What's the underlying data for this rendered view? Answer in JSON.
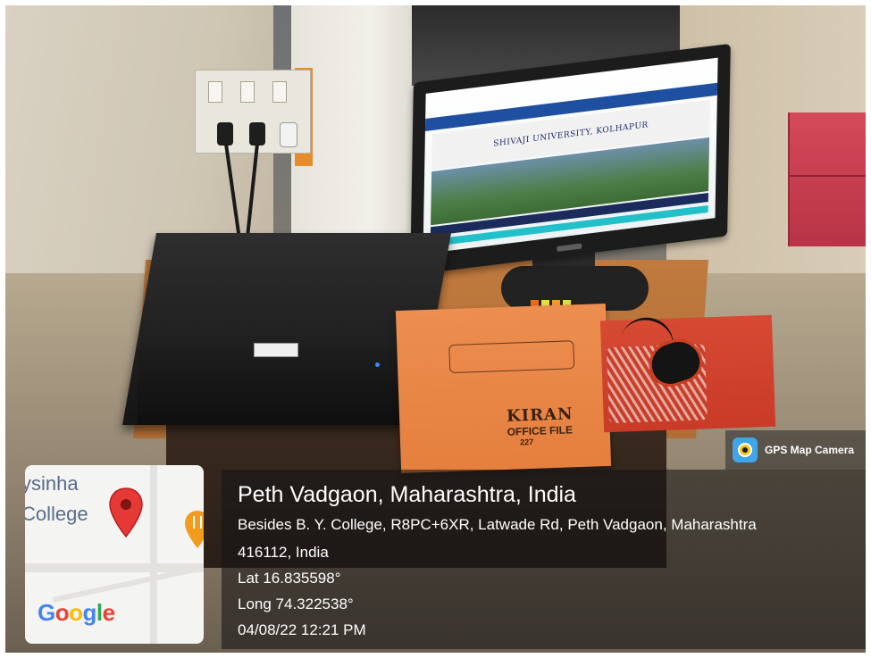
{
  "photo": {
    "monitor_screen": {
      "banner_text": "SHIVAJI UNIVERSITY, KOLHAPUR"
    },
    "file_cover": {
      "brand": "KIRAN",
      "subtitle": "OFFICE FILE",
      "number": "227"
    }
  },
  "overlay": {
    "app_badge": {
      "icon": "gps-map-camera-icon",
      "label": "GPS Map Camera"
    },
    "location": {
      "title": "Peth Vadgaon, Maharashtra, India",
      "address_line1": "Besides B. Y. College, R8PC+6XR, Latwade Rd, Peth Vadgaon, Maharashtra",
      "address_line2": "416112, India",
      "lat": "Lat 16.835598°",
      "long": "Long 74.322538°",
      "datetime": "04/08/22 12:21 PM"
    },
    "map": {
      "place_label_line1": "ysinha",
      "place_label_line2": "College",
      "pin_icon": "map-pin-icon",
      "poi_icon": "restaurant-icon",
      "logo": "Google",
      "colors": {
        "pin": "#e53935",
        "poi": "#f29c1f",
        "google_blue": "#4285f4",
        "google_red": "#ea4335",
        "google_yellow": "#fbbc05",
        "google_green": "#34a853"
      }
    }
  }
}
